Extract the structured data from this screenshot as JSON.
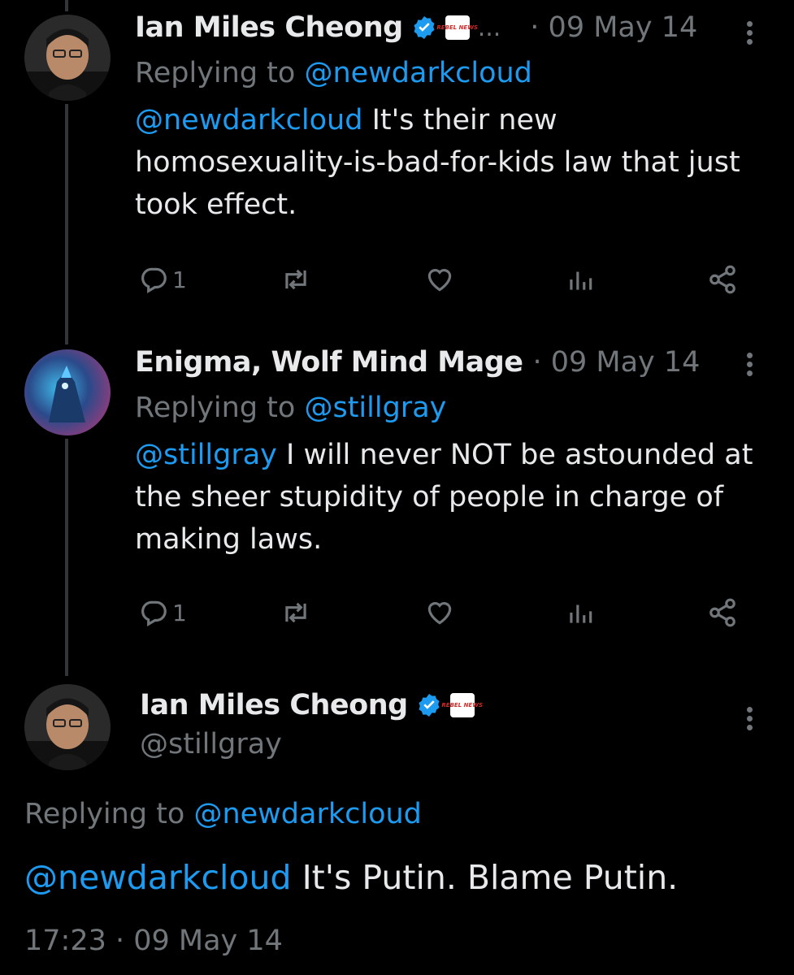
{
  "thread": [
    {
      "name": "Ian Miles Cheong",
      "verified": true,
      "affiliation_badge": "REBEL NEWS",
      "ellipsis": "...",
      "time": "· 09 May 14",
      "replying_prefix": "Replying to ",
      "replying_handle": "@newdarkcloud",
      "mention": "@newdarkcloud",
      "body": " It's their new homosexuality-is-bad-for-kids law that just took effect.",
      "reply_count": "1"
    },
    {
      "name": "Enigma, Wolf Mind Mage",
      "verified": false,
      "time": "· 09 May 14",
      "replying_prefix": "Replying to ",
      "replying_handle": "@stillgray",
      "mention": "@stillgray",
      "body": " I will never NOT be astounded at the sheer stupidity of people in charge of making laws.",
      "reply_count": "1"
    }
  ],
  "main": {
    "name": "Ian Miles Cheong",
    "verified": true,
    "affiliation_badge": "REBEL NEWS",
    "handle": "@stillgray",
    "replying_prefix": "Replying to ",
    "replying_handle": "@newdarkcloud",
    "mention": "@newdarkcloud",
    "body": " It's Putin. Blame Putin.",
    "timestamp": "17:23 · 09 May 14"
  },
  "icons": [
    "verified-badge-icon",
    "reply-icon",
    "retweet-icon",
    "like-icon",
    "views-icon",
    "share-icon",
    "more-icon"
  ],
  "colors": {
    "background": "#000000",
    "text": "#e7e9ea",
    "muted": "#71767b",
    "link": "#1d9bf0",
    "verified": "#1d9bf0"
  }
}
